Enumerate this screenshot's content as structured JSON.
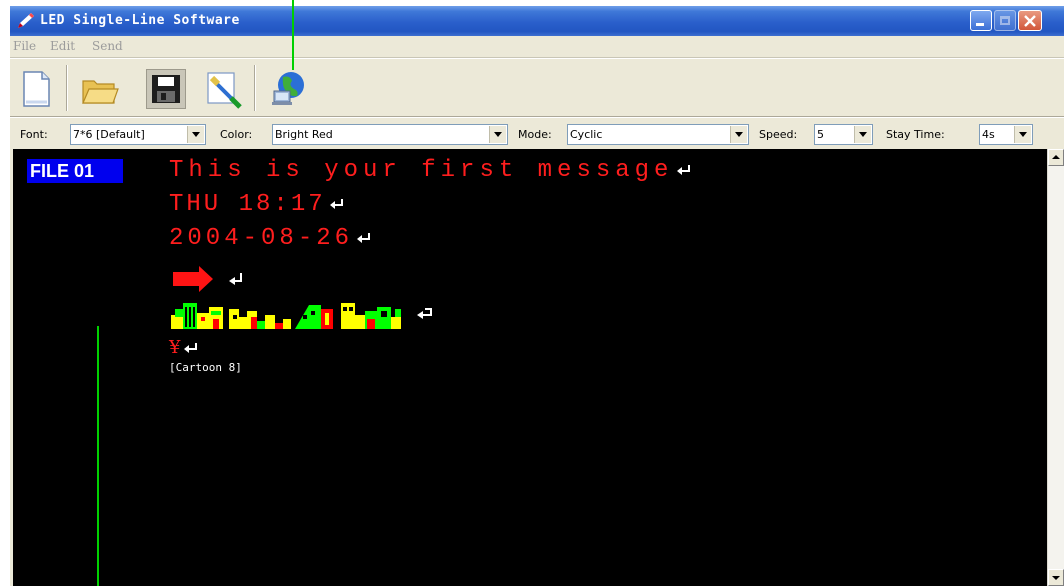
{
  "window": {
    "title": "LED Single-Line Software",
    "app_icon": "pencil-icon",
    "caption_buttons": [
      "minimize-icon",
      "maximize-icon",
      "close-icon"
    ]
  },
  "menu": [
    "File",
    "Edit",
    "Send"
  ],
  "toolbar": {
    "buttons": [
      "new-file-icon",
      "open-folder-icon",
      "save-disk-icon",
      "edit-brush-icon",
      "send-globe-icon"
    ]
  },
  "options": {
    "font_label": "Font:",
    "font_value": "7*6 [Default]",
    "color_label": "Color:",
    "color_value": "Bright Red",
    "mode_label": "Mode:",
    "mode_value": "Cyclic",
    "speed_label": "Speed:",
    "speed_value": "5",
    "stay_label": "Stay Time:",
    "stay_value": "4s"
  },
  "editor": {
    "file_badge": "FILE 01",
    "lines": [
      "This is your first message",
      "THU 18:17",
      "2004-08-26"
    ],
    "arrow": "right-arrow-icon",
    "cartoon_image": "city-skyline-graphic",
    "yen_symbol": "¥",
    "cartoon_label": "[Cartoon 8]",
    "text_color": "#ff1e1e",
    "badge_color": "#0000ee"
  },
  "colors": {
    "titlebar": "#2a5fcb",
    "editor_bg": "#000000",
    "callout_line": "#00d000"
  }
}
